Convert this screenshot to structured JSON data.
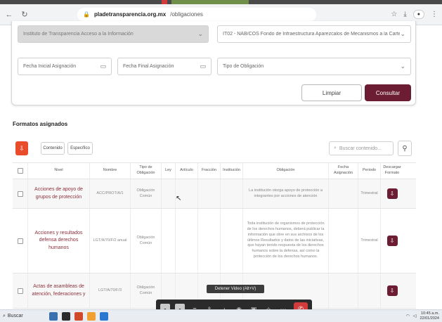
{
  "browser": {
    "address_host": "pladetransparencia.org.mx",
    "address_path": "/obligaciones"
  },
  "filters": {
    "sujeto_obligado": "Instituto de Transparencia Acceso a la Información",
    "formato": "IT02 - NAB/COS Fondo de Infraestructura Aparezcalos de Mecanismos a la Cartera",
    "fecha_inicial": "Fecha Inicial Asignación",
    "fecha_final": "Fecha Final Asignación",
    "tipo_obligacion": "Tipo de Obligación",
    "limpiar_label": "Limpiar",
    "consultar_label": "Consultar"
  },
  "section": {
    "title": "Formatos asignados"
  },
  "toolbar": {
    "export_label": "⇩",
    "btn1_label": "Contenido",
    "btn2_label": "Específico",
    "search_placeholder": "Buscar contenido..."
  },
  "table": {
    "headers": [
      "Nivel",
      "Nombre",
      "Tipo de Obligación",
      "Ley",
      "Artículo",
      "Fracción",
      "Institución",
      "Obligación",
      "Fecha Asignación",
      "Periodo",
      "Descargar Formato"
    ],
    "rows": [
      {
        "nivel": "Acciones de apoyo de grupos de protección",
        "nombre": "ACC/PROT/A/1",
        "tipo": "Obligación Común",
        "obligacion": "La institución otorga apoyo de protección a integrantes por acciones de atención",
        "periodo": "Trimestral"
      },
      {
        "nivel": "Acciones y resultados defensa derechos humanos",
        "nombre": "LGT/A/70/F/2 anual",
        "tipo": "Obligación Común",
        "obligacion": "Toda institución de organismos de protección de los derechos humanos, deberá publicar la información que obre en sus archivos de los últimos Resultados y datos de las iniciativas, que hayan tenido respuesta de los derechos humanos sobre la defensa, así como la protección de los derechos humanos.",
        "periodo": "Trimestral"
      },
      {
        "nivel": "Actas de asambleas de atención, federaciones y",
        "nombre": "LGT/A/70/F/3",
        "tipo": "Obligación Común",
        "obligacion": "",
        "periodo": ""
      }
    ]
  },
  "overlay": {
    "tooltip": "Detener Video (Alt+V)"
  },
  "taskbar": {
    "search_label": "Buscar",
    "time": "10:45 a.m.",
    "date": "22/01/2024"
  }
}
